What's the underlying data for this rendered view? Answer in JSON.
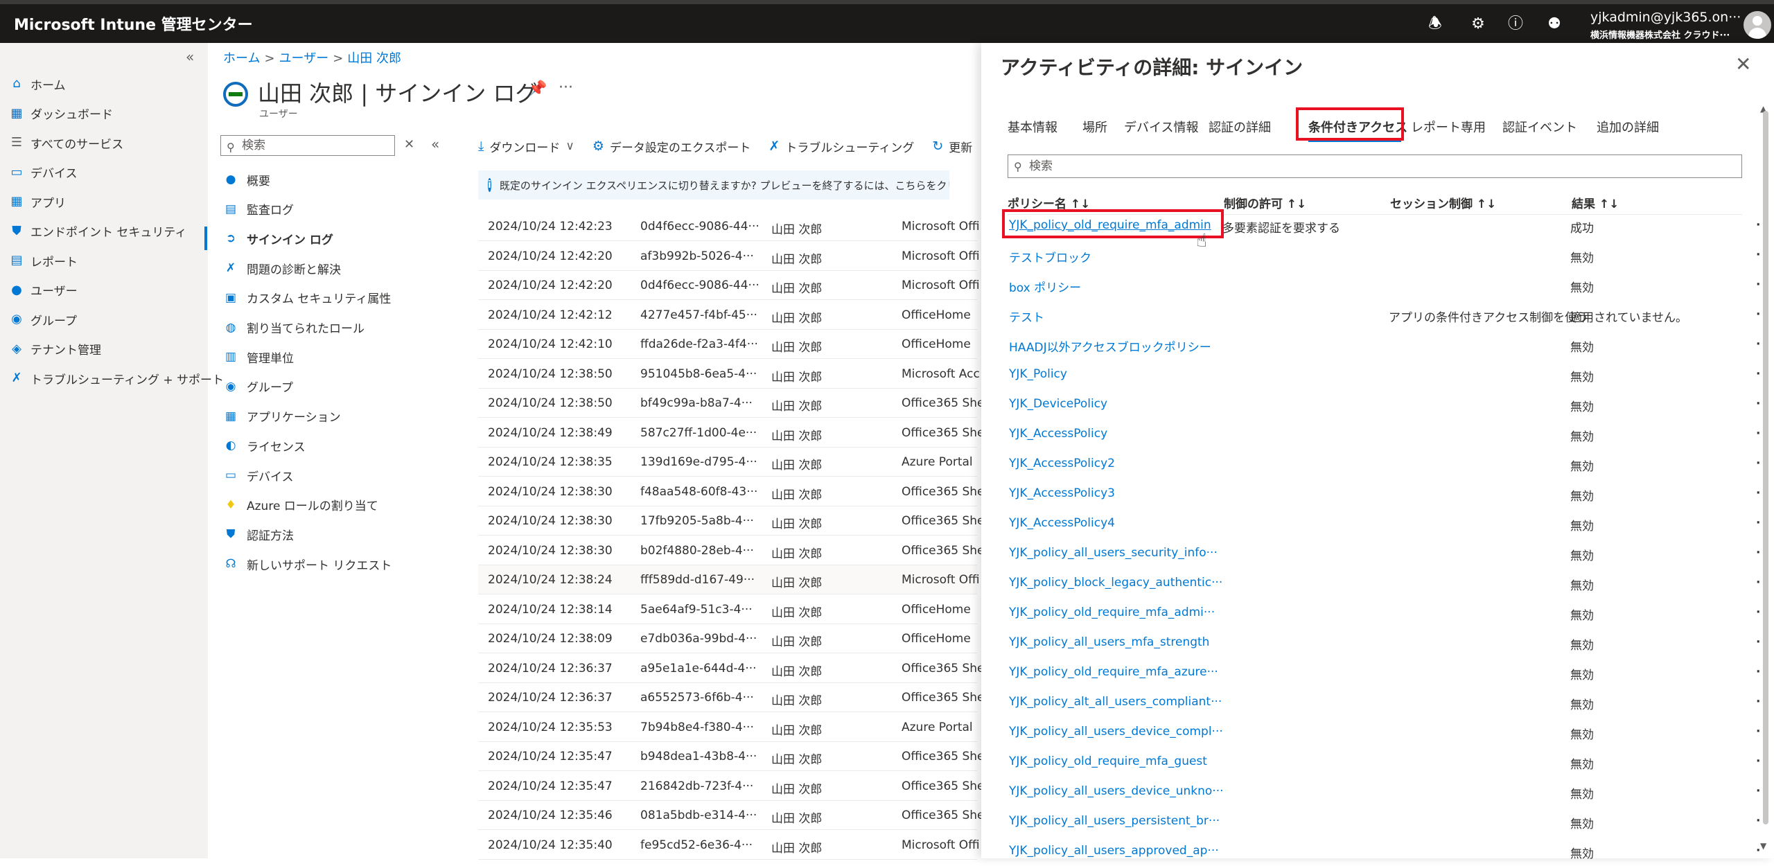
{
  "topbar": {
    "brand": "Microsoft Intune 管理センター",
    "account_email": "yjkadmin@yjk365.on···",
    "account_org": "横浜情報機器株式会社 クラウド···"
  },
  "leftnav": {
    "items": [
      {
        "label": "ホーム",
        "icon": "home-icon"
      },
      {
        "label": "ダッシュボード",
        "icon": "dashboard-icon"
      },
      {
        "label": "すべてのサービス",
        "icon": "list-icon"
      },
      {
        "label": "デバイス",
        "icon": "device-icon"
      },
      {
        "label": "アプリ",
        "icon": "apps-grid-icon"
      },
      {
        "label": "エンドポイント セキュリティ",
        "icon": "shield-icon"
      },
      {
        "label": "レポート",
        "icon": "report-icon"
      },
      {
        "label": "ユーザー",
        "icon": "user-icon"
      },
      {
        "label": "グループ",
        "icon": "group-icon"
      },
      {
        "label": "テナント管理",
        "icon": "tenant-icon"
      },
      {
        "label": "トラブルシューティング + サポート",
        "icon": "wrench-icon"
      }
    ]
  },
  "breadcrumb": [
    "ホーム",
    "ユーザー",
    "山田 次郎"
  ],
  "page": {
    "title": "山田 次郎 | サインイン ログ",
    "subtitle": "ユーザー"
  },
  "subnav": {
    "search_placeholder": "検索",
    "items": [
      {
        "label": "概要",
        "icon": "user-icon"
      },
      {
        "label": "監査ログ",
        "icon": "audit-log-icon"
      },
      {
        "label": "サインイン ログ",
        "icon": "signin-icon",
        "active": true
      },
      {
        "label": "問題の診断と解決",
        "icon": "wrench-icon"
      },
      {
        "label": "カスタム セキュリティ属性",
        "icon": "attribute-icon"
      },
      {
        "label": "割り当てられたロール",
        "icon": "roles-icon"
      },
      {
        "label": "管理単位",
        "icon": "admin-unit-icon"
      },
      {
        "label": "グループ",
        "icon": "group-icon"
      },
      {
        "label": "アプリケーション",
        "icon": "apps-grid-icon"
      },
      {
        "label": "ライセンス",
        "icon": "license-icon"
      },
      {
        "label": "デバイス",
        "icon": "device-icon"
      },
      {
        "label": "Azure ロールの割り当て",
        "icon": "key-icon"
      },
      {
        "label": "認証方法",
        "icon": "auth-shield-icon"
      },
      {
        "label": "新しいサポート リクエスト",
        "icon": "support-icon"
      }
    ]
  },
  "toolbar": {
    "download": "ダウンロード",
    "export": "データ設定のエクスポート",
    "troubleshoot": "トラブルシューティング",
    "refresh": "更新"
  },
  "infobar": {
    "text": "既定のサインイン エクスペリエンスに切り替えますか? プレビューを終了するには、こちらをクリックします。 →"
  },
  "signin_logs": [
    {
      "date": "2024/10/24 12:42:23",
      "id": "0d4f6ecc-9086-44···",
      "user": "山田 次郎",
      "app": "Microsoft Offi"
    },
    {
      "date": "2024/10/24 12:42:20",
      "id": "af3b992b-5026-4···",
      "user": "山田 次郎",
      "app": "Microsoft Offi"
    },
    {
      "date": "2024/10/24 12:42:20",
      "id": "0d4f6ecc-9086-44···",
      "user": "山田 次郎",
      "app": "Microsoft Offi"
    },
    {
      "date": "2024/10/24 12:42:12",
      "id": "4277e457-f4bf-45···",
      "user": "山田 次郎",
      "app": "OfficeHome"
    },
    {
      "date": "2024/10/24 12:42:10",
      "id": "ffda26de-f2a3-4f4···",
      "user": "山田 次郎",
      "app": "OfficeHome"
    },
    {
      "date": "2024/10/24 12:38:50",
      "id": "951045b8-6ea5-4···",
      "user": "山田 次郎",
      "app": "Microsoft Acc"
    },
    {
      "date": "2024/10/24 12:38:50",
      "id": "bf49c99a-b8a7-4···",
      "user": "山田 次郎",
      "app": "Office365 She"
    },
    {
      "date": "2024/10/24 12:38:49",
      "id": "587c27ff-1d00-4e···",
      "user": "山田 次郎",
      "app": "Office365 She"
    },
    {
      "date": "2024/10/24 12:38:35",
      "id": "139d169e-d795-4···",
      "user": "山田 次郎",
      "app": "Azure Portal"
    },
    {
      "date": "2024/10/24 12:38:30",
      "id": "f48aa548-60f8-43···",
      "user": "山田 次郎",
      "app": "Office365 She"
    },
    {
      "date": "2024/10/24 12:38:30",
      "id": "17fb9205-5a8b-4···",
      "user": "山田 次郎",
      "app": "Office365 She"
    },
    {
      "date": "2024/10/24 12:38:30",
      "id": "b02f4880-28eb-4···",
      "user": "山田 次郎",
      "app": "Office365 She"
    },
    {
      "date": "2024/10/24 12:38:24",
      "id": "fff589dd-d167-49···",
      "user": "山田 次郎",
      "app": "Microsoft Offi"
    },
    {
      "date": "2024/10/24 12:38:14",
      "id": "5ae64af9-51c3-4···",
      "user": "山田 次郎",
      "app": "OfficeHome"
    },
    {
      "date": "2024/10/24 12:38:09",
      "id": "e7db036a-99bd-4···",
      "user": "山田 次郎",
      "app": "OfficeHome"
    },
    {
      "date": "2024/10/24 12:36:37",
      "id": "a95e1a1e-644d-4···",
      "user": "山田 次郎",
      "app": "Office365 She"
    },
    {
      "date": "2024/10/24 12:36:37",
      "id": "a6552573-6f6b-4···",
      "user": "山田 次郎",
      "app": "Office365 She"
    },
    {
      "date": "2024/10/24 12:35:53",
      "id": "7b94b8e4-f380-4···",
      "user": "山田 次郎",
      "app": "Azure Portal"
    },
    {
      "date": "2024/10/24 12:35:47",
      "id": "b948dea1-43b8-4···",
      "user": "山田 次郎",
      "app": "Office365 She"
    },
    {
      "date": "2024/10/24 12:35:47",
      "id": "216842db-723f-4···",
      "user": "山田 次郎",
      "app": "Office365 She"
    },
    {
      "date": "2024/10/24 12:35:46",
      "id": "081a5bdb-e314-4···",
      "user": "山田 次郎",
      "app": "Office365 She"
    },
    {
      "date": "2024/10/24 12:35:40",
      "id": "fe95cd52-6e36-4···",
      "user": "山田 次郎",
      "app": "Microsoft Offi"
    }
  ],
  "panel": {
    "title": "アクティビティの詳細: サインイン",
    "tabs": [
      "基本情報",
      "場所",
      "デバイス情報",
      "認証の詳細",
      "条件付きアクセス",
      "レポート専用",
      "認証イベント",
      "追加の詳細"
    ],
    "selected_tab": "条件付きアクセス",
    "search_placeholder": "検索",
    "columns": [
      "ポリシー名 ↑↓",
      "制御の許可 ↑↓",
      "セッション制御 ↑↓",
      "結果 ↑↓"
    ],
    "policies": [
      {
        "name": "YJK_policy_old_require_mfa_admin",
        "grant": "多要素認証を要求する",
        "session": "",
        "result": "成功"
      },
      {
        "name": "テストブロック",
        "grant": "",
        "session": "",
        "result": "無効"
      },
      {
        "name": "box ポリシー",
        "grant": "",
        "session": "",
        "result": "無効"
      },
      {
        "name": "テスト",
        "grant": "",
        "session": "アプリの条件付きアクセス制御を使う",
        "result": "適用されていません。"
      },
      {
        "name": "HAADJ以外アクセスブロックポリシー",
        "grant": "",
        "session": "",
        "result": "無効"
      },
      {
        "name": "YJK_Policy",
        "grant": "",
        "session": "",
        "result": "無効"
      },
      {
        "name": "YJK_DevicePolicy",
        "grant": "",
        "session": "",
        "result": "無効"
      },
      {
        "name": "YJK_AccessPolicy",
        "grant": "",
        "session": "",
        "result": "無効"
      },
      {
        "name": "YJK_AccessPolicy2",
        "grant": "",
        "session": "",
        "result": "無効"
      },
      {
        "name": "YJK_AccessPolicy3",
        "grant": "",
        "session": "",
        "result": "無効"
      },
      {
        "name": "YJK_AccessPolicy4",
        "grant": "",
        "session": "",
        "result": "無効"
      },
      {
        "name": "YJK_policy_all_users_security_info···",
        "grant": "",
        "session": "",
        "result": "無効"
      },
      {
        "name": "YJK_policy_block_legacy_authentic···",
        "grant": "",
        "session": "",
        "result": "無効"
      },
      {
        "name": "YJK_policy_old_require_mfa_admi···",
        "grant": "",
        "session": "",
        "result": "無効"
      },
      {
        "name": "YJK_policy_all_users_mfa_strength",
        "grant": "",
        "session": "",
        "result": "無効"
      },
      {
        "name": "YJK_policy_old_require_mfa_azure···",
        "grant": "",
        "session": "",
        "result": "無効"
      },
      {
        "name": "YJK_policy_alt_all_users_compliant···",
        "grant": "",
        "session": "",
        "result": "無効"
      },
      {
        "name": "YJK_policy_all_users_device_compl···",
        "grant": "",
        "session": "",
        "result": "無効"
      },
      {
        "name": "YJK_policy_old_require_mfa_guest",
        "grant": "",
        "session": "",
        "result": "無効"
      },
      {
        "name": "YJK_policy_all_users_device_unkno···",
        "grant": "",
        "session": "",
        "result": "無効"
      },
      {
        "name": "YJK_policy_all_users_persistent_br···",
        "grant": "",
        "session": "",
        "result": "無効"
      },
      {
        "name": "YJK_policy_all_users_approved_ap···",
        "grant": "",
        "session": "",
        "result": "無効"
      }
    ]
  },
  "colors": {
    "accent": "#0078d4",
    "highlight_box": "#e81123",
    "topbar": "#1b1a19"
  }
}
